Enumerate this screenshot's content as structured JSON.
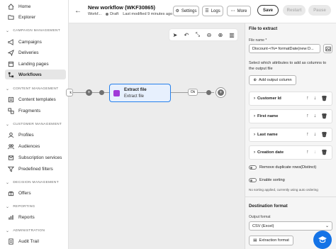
{
  "sidebar": {
    "items_top": [
      {
        "label": "Home",
        "icon": "home-icon"
      },
      {
        "label": "Explorer",
        "icon": "folder-icon"
      }
    ],
    "sections": [
      {
        "title": "CAMPAIGN MANAGEMENT",
        "items": [
          {
            "label": "Campaigns",
            "icon": "campaign-icon"
          },
          {
            "label": "Deliveries",
            "icon": "send-icon"
          },
          {
            "label": "Landing pages",
            "icon": "page-icon"
          },
          {
            "label": "Workflows",
            "icon": "workflow-icon",
            "active": true
          }
        ]
      },
      {
        "title": "CONTENT MANAGEMENT",
        "items": [
          {
            "label": "Content templates",
            "icon": "template-icon"
          },
          {
            "label": "Fragments",
            "icon": "fragment-icon"
          }
        ]
      },
      {
        "title": "CUSTOMER MANAGEMENT",
        "items": [
          {
            "label": "Profiles",
            "icon": "profile-icon"
          },
          {
            "label": "Audiences",
            "icon": "audience-icon"
          },
          {
            "label": "Subscription services",
            "icon": "subscription-icon"
          },
          {
            "label": "Predefined filters",
            "icon": "filter-icon"
          }
        ]
      },
      {
        "title": "DECISION MANAGEMENT",
        "items": [
          {
            "label": "Offers",
            "icon": "offer-icon"
          }
        ]
      },
      {
        "title": "REPORTING",
        "items": [
          {
            "label": "Reports",
            "icon": "report-icon"
          }
        ]
      },
      {
        "title": "ADMINISTRATION",
        "items": [
          {
            "label": "Audit Trail",
            "icon": "audit-icon"
          }
        ]
      }
    ]
  },
  "header": {
    "title": "New workflow (WKF30865)",
    "breadcrumb": "Workf...",
    "status": "Draft",
    "modified": "Last modified 9 minutes ago",
    "settings": "Settings",
    "logs": "Logs",
    "more": "More",
    "save": "Save",
    "restart": "Restart",
    "pause": "Pause"
  },
  "canvas": {
    "left_edge_label": "k",
    "activity_title": "Extract file",
    "activity_sub": "Extract file",
    "ok_label": "Ok"
  },
  "panel": {
    "title": "File to extract",
    "file_name_label": "File name",
    "file_name_required": "*",
    "file_name_value": "Discount-<%= formatDate(new D...",
    "attributes_help": "Select which attributes to add as columns to the output file",
    "add_output_column": "Add output column",
    "columns": [
      "Customer Id",
      "First name",
      "Last name",
      "Creation date"
    ],
    "remove_duplicates": "Remove duplicate rows(Distinct)",
    "enable_sorting": "Enable sorting",
    "sorting_note": "No sorting applied, currently using auto ordering",
    "destination_title": "Destination format",
    "output_format_label": "Output format",
    "output_format_value": "CSV (Excel)",
    "extraction_format": "Extraction format"
  },
  "colors": {
    "accent": "#1473e6",
    "activity_border": "#2680eb",
    "activity_bg": "#e7f0fd",
    "save_bg": "#ffffff",
    "purple_icon": "#a03ad8"
  }
}
